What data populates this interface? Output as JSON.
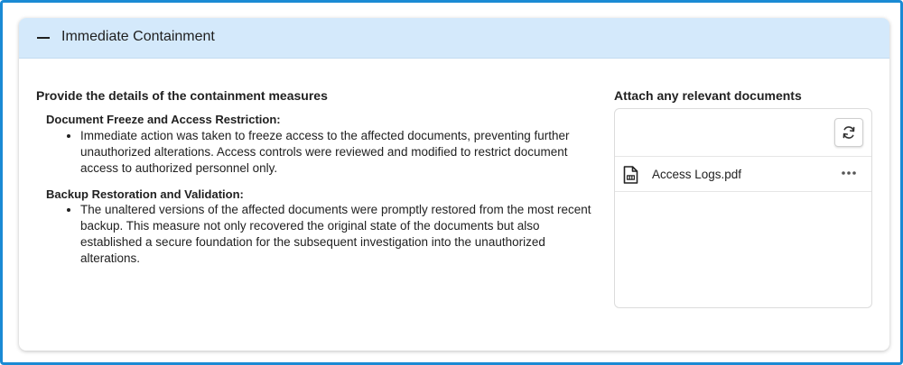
{
  "panel": {
    "title": "Immediate Containment",
    "collapse_icon": "minus-icon"
  },
  "containment": {
    "heading": "Provide the details of the containment measures",
    "measures": [
      {
        "title": "Document Freeze and Access Restriction:",
        "bullet": "Immediate action was taken to freeze access to the affected documents, preventing further unauthorized alterations. Access controls were reviewed and modified to restrict document access to authorized personnel only."
      },
      {
        "title": "Backup Restoration and Validation:",
        "bullet": "The unaltered versions of the affected documents were promptly restored from the most recent backup. This measure not only recovered the original state of the documents but also established a secure foundation for the subsequent investigation into the unauthorized alterations."
      }
    ]
  },
  "attachments": {
    "heading": "Attach any relevant documents",
    "refresh_icon": "refresh-icon",
    "files": [
      {
        "name": "Access Logs.pdf",
        "icon": "pdf-file-icon",
        "menu_icon": "more-horizontal-icon"
      }
    ]
  },
  "colors": {
    "frame_border": "#1a8ad4",
    "header_background": "#d4e9fb"
  }
}
